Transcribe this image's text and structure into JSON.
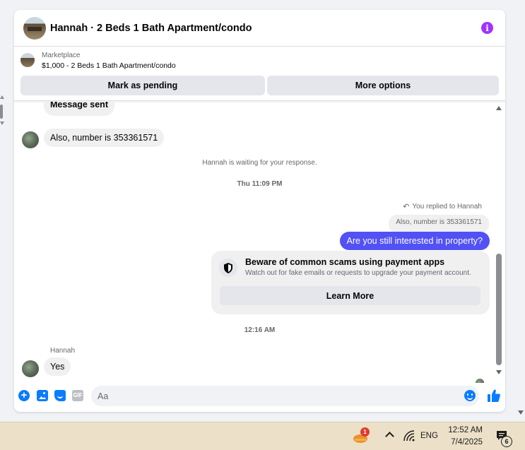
{
  "header": {
    "title": "Hannah · 2 Beds 1 Bath Apartment/condo"
  },
  "listing": {
    "source": "Marketplace",
    "price_title": "$1,000 - 2 Beds 1 Bath Apartment/condo",
    "buttons": {
      "pending": "Mark as pending",
      "more": "More options"
    }
  },
  "messages": {
    "cut_message": "Message sent",
    "incoming_1": "Also, number is 353361571",
    "waiting_note": "Hannah is waiting for your response.",
    "timestamp_1": "Thu 11:09 PM",
    "replied_note": "You replied to Hannah",
    "quoted_text": "Also, number is 353361571",
    "outgoing_1": "Are you still interested in property?",
    "scam_card": {
      "title": "Beware of common scams using payment apps",
      "description": "Watch out for fake emails or requests to upgrade your payment account.",
      "button": "Learn More"
    },
    "timestamp_2": "12:16 AM",
    "sender_name": "Hannah",
    "incoming_2": "Yes"
  },
  "composer": {
    "placeholder": "Aa",
    "gif_label": "GIF"
  },
  "taskbar": {
    "tray_badge": "1",
    "language": "ENG",
    "time": "12:52 AM",
    "date": "7/4/2025",
    "notification_count": "6"
  },
  "colors": {
    "accent_blue": "#0a7cff",
    "outgoing_bubble": "#5151f5",
    "info_purple": "#a033ff",
    "taskbar_bg": "#ece1c8"
  }
}
